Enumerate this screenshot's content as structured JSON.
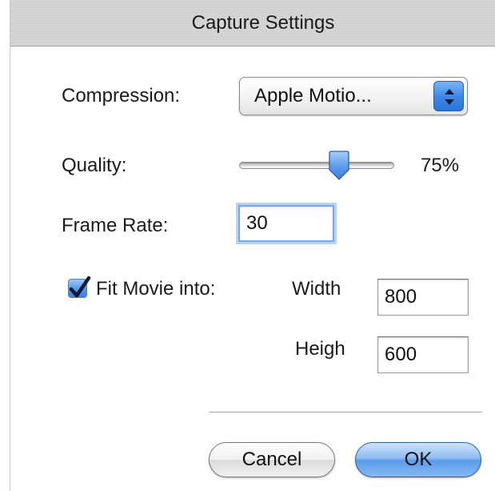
{
  "window": {
    "title": "Capture Settings"
  },
  "compression": {
    "label": "Compression:",
    "selected": "Apple Motio..."
  },
  "quality": {
    "label": "Quality:",
    "value_label": "75%",
    "value_fraction": 0.67
  },
  "frame_rate": {
    "label": "Frame Rate:",
    "value": "30"
  },
  "fit_movie": {
    "label": "Fit Movie into:",
    "checked": true,
    "width_label": "Width",
    "width_value": "800",
    "height_label": "Heigh",
    "height_value": "600"
  },
  "buttons": {
    "cancel": "Cancel",
    "ok": "OK"
  },
  "colors": {
    "accent": "#4f93e9",
    "focus_ring": "#7aa7e6"
  }
}
